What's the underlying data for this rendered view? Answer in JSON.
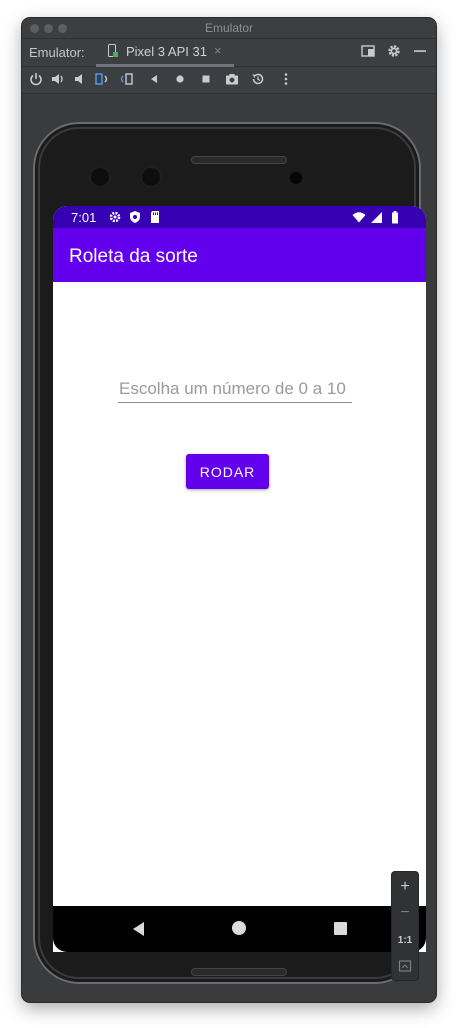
{
  "window": {
    "title": "Emulator"
  },
  "tabbar": {
    "label": "Emulator:",
    "device_tab": "Pixel 3 API 31",
    "close_glyph": "×"
  },
  "statusbar": {
    "time": "7:01"
  },
  "app": {
    "title": "Roleta da sorte",
    "input_placeholder": "Escolha um número de 0 a 10",
    "input_value": "",
    "button_label": "RODAR"
  },
  "side_panel": {
    "zoom_in": "+",
    "zoom_out": "−",
    "ratio": "1:1"
  },
  "colors": {
    "statusbar": "#3700b3",
    "appbar": "#6200ee",
    "button": "#6200ee"
  },
  "icons": {
    "toolbar": [
      "power-icon",
      "volume-up-icon",
      "volume-down-icon",
      "rotate-left-icon",
      "rotate-right-icon",
      "back-icon",
      "home-icon",
      "overview-icon",
      "camera-icon",
      "snapshot-icon",
      "more-icon"
    ],
    "status_left": [
      "settings-icon",
      "shield-icon",
      "sd-card-icon"
    ],
    "status_right": [
      "wifi-icon",
      "signal-icon",
      "battery-icon"
    ]
  }
}
